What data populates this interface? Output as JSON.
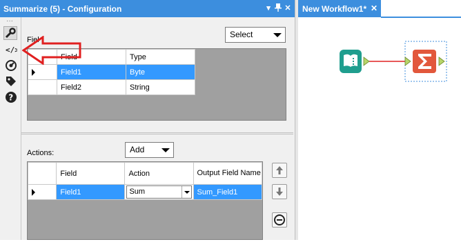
{
  "config_panel": {
    "title": "Summarize (5) - Configuration",
    "title_buttons": {
      "dropdown": "▾",
      "pin": "📌",
      "close": "✕"
    }
  },
  "toolbar": {
    "icons": [
      "wrench-icon",
      "xml-code-icon",
      "gauge-icon",
      "tag-icon",
      "help-icon"
    ],
    "overflow": "···"
  },
  "fields_section": {
    "label": "Fiel",
    "select_button": "Select",
    "columns": [
      "Field",
      "Type"
    ],
    "rows": [
      {
        "field": "Field1",
        "type": "Byte",
        "selected": true
      },
      {
        "field": "Field2",
        "type": "String",
        "selected": false
      }
    ]
  },
  "actions_section": {
    "label": "Actions:",
    "add_button": "Add",
    "columns": [
      "Field",
      "Action",
      "Output Field Name"
    ],
    "rows": [
      {
        "field": "Field1",
        "action": "Sum",
        "output": "Sum_Field1",
        "selected": true
      }
    ]
  },
  "canvas": {
    "tab_label": "New Workflow1*",
    "tab_close": "✕",
    "tools": [
      "input-book-tool",
      "summarize-sigma-tool"
    ],
    "colors": {
      "accent": "#3c8ede",
      "input_tool": "#1f9e8e",
      "summarize_tool": "#e2573b",
      "connection": "#e02020"
    }
  },
  "annotation": {
    "arrow_color": "#e02020"
  }
}
